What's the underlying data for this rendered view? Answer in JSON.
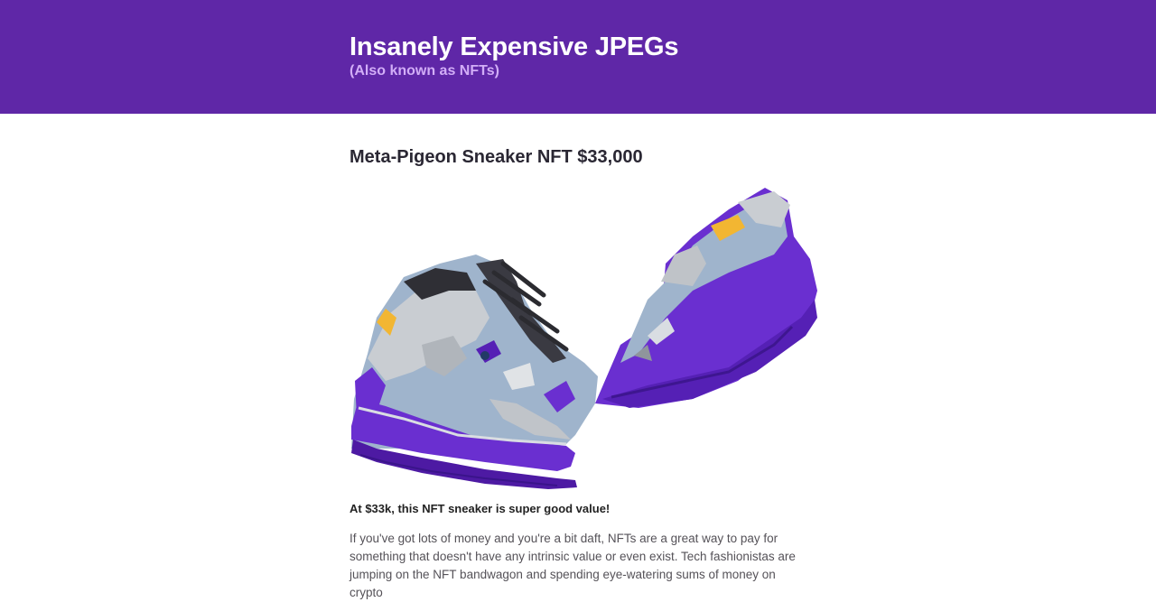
{
  "header": {
    "title": "Insanely Expensive JPEGs",
    "subtitle": "(Also known as NFTs)",
    "background_color": "#5f27a7",
    "subtitle_color": "#d2aef7"
  },
  "article": {
    "title": "Meta-Pigeon Sneaker NFT $33,000",
    "image_alt": "Meta-Pigeon Sneaker NFT",
    "lead": "At $33k, this NFT sneaker is super good value!",
    "body": "If you've got lots of money and you're a bit daft, NFTs are a great way to pay for something that doesn't have any intrinsic value or even exist. Tech fashionistas are jumping on the NFT bandwagon and spending eye-watering sums of money on crypto"
  },
  "colors": {
    "accent_purple": "#6a2fd0",
    "text_dark": "#2a2733"
  }
}
